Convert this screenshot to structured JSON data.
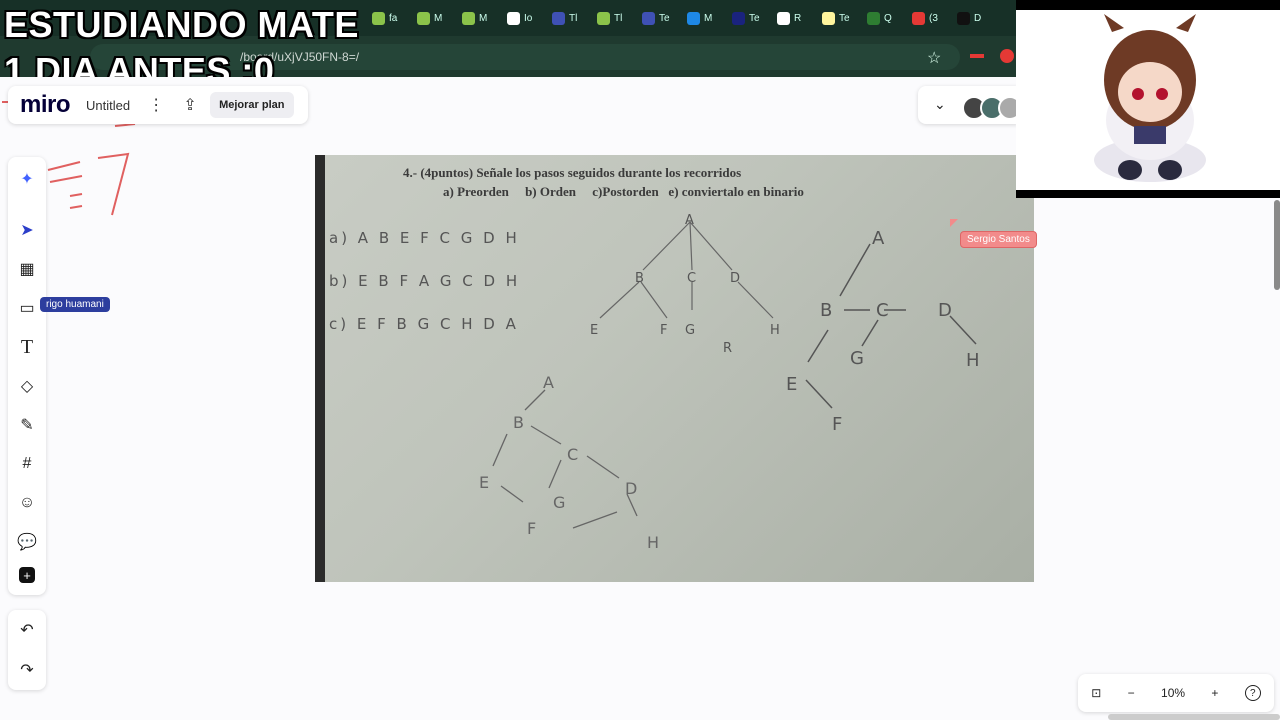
{
  "overlay": {
    "line1": "ESTUDIANDO MATE",
    "line2": "1 DIA ANTES :0"
  },
  "browser": {
    "url_fragment": "/board/uXjVJ50FN-8=/",
    "tabs": [
      {
        "label": "fa",
        "color": "#8bc34a"
      },
      {
        "label": "M",
        "color": "#8bc34a"
      },
      {
        "label": "M",
        "color": "#8bc34a"
      },
      {
        "label": "Io",
        "color": "#ffffff"
      },
      {
        "label": "Tl",
        "color": "#3f51b5"
      },
      {
        "label": "Tl",
        "color": "#8bc34a"
      },
      {
        "label": "Te",
        "color": "#3f51b5"
      },
      {
        "label": "M",
        "color": "#1e88e5"
      },
      {
        "label": "Te",
        "color": "#1a237e"
      },
      {
        "label": "R",
        "color": "#ffffff"
      },
      {
        "label": "Te",
        "color": "#fff59d"
      },
      {
        "label": "Q",
        "color": "#2e7d32"
      },
      {
        "label": "(3",
        "color": "#e53935"
      },
      {
        "label": "D",
        "color": "#111111"
      }
    ]
  },
  "miro": {
    "logo": "miro",
    "board_name": "Untitled",
    "upgrade_label": "Mejorar plan",
    "zoom": "10%",
    "collaborator_left": "rigo huamani",
    "collaborator_right": "Sergio Santos"
  },
  "photo": {
    "question": "4.- (4puntos) Señale los pasos seguidos durante los recorridos",
    "options": "a) Preorden     b) Orden     c)Postorden   e) conviertalo en binario",
    "answer_a": "a) A B E F C G D H",
    "answer_b": "b) E B F A G C D H",
    "answer_c": "c) E F B G C H D A"
  },
  "colors": {
    "collab_left": "#2d3e9e",
    "collab_right": "#f28b8b",
    "accent": "#4262ff"
  }
}
